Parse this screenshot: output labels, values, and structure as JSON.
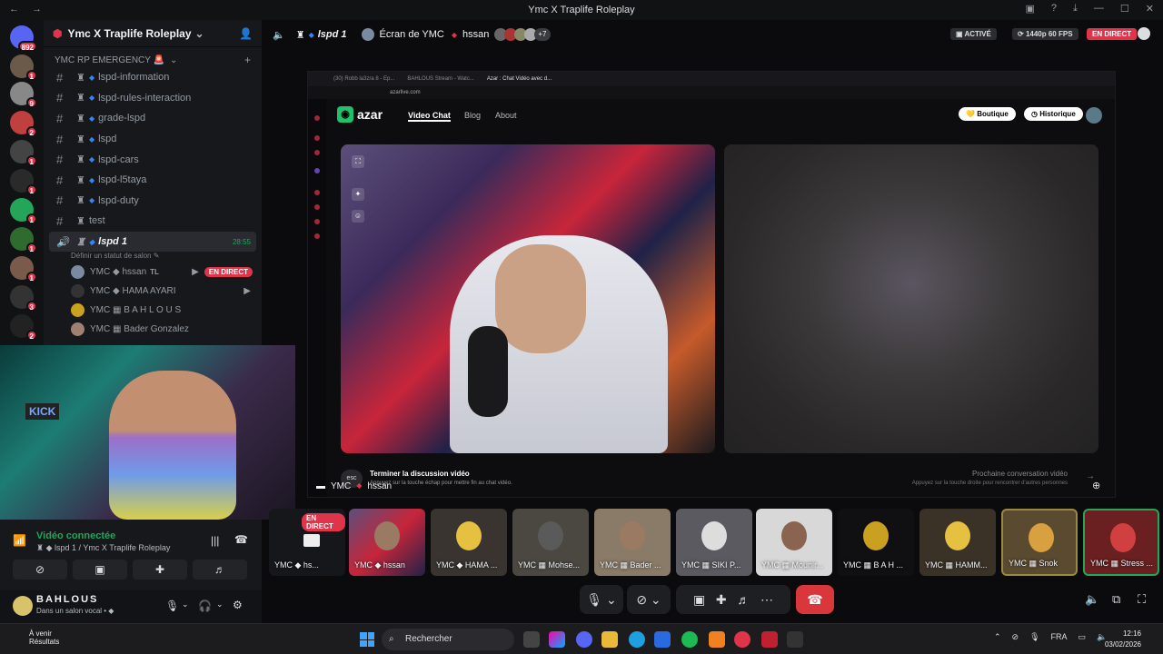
{
  "window": {
    "title": "Ymc X Traplife Roleplay"
  },
  "server": {
    "name": "Ymc X Traplife Roleplay",
    "rail_badges": [
      "892",
      "1",
      "9",
      "2",
      "1",
      "1",
      "1",
      "1",
      "1",
      "3",
      "2"
    ]
  },
  "channels": {
    "category": "YMC RP EMERGENCY 🚨",
    "list": [
      {
        "name": "lspd-information"
      },
      {
        "name": "lspd-rules-interaction"
      },
      {
        "name": "grade-lspd"
      },
      {
        "name": "lspd"
      },
      {
        "name": "lspd-cars"
      },
      {
        "name": "lspd-l5taya"
      },
      {
        "name": "lspd-duty"
      },
      {
        "name": "test"
      }
    ],
    "active_voice": {
      "name": "lspd 1",
      "time": "28:55",
      "status_placeholder": "Définir un statut de salon"
    },
    "voice_users": [
      {
        "name": "YMC ◆ hssan",
        "tag": "TL",
        "live": "EN DIRECT"
      },
      {
        "name": "YMC ◆ HAMA AYARI"
      },
      {
        "name": "YMC ▦ B A H L O U S"
      },
      {
        "name": "YMC ▦ Bader Gonzalez"
      }
    ]
  },
  "webcam": {
    "sign": "KICK"
  },
  "voice_panel": {
    "status": "Vidéo connectée",
    "subtitle": "lspd 1 / Ymc X Traplife Roleplay"
  },
  "user": {
    "name": "BAHLOUS",
    "status": "Dans un salon vocal • ◆"
  },
  "stage": {
    "channel": "lspd 1",
    "screen": "Écran de YMC",
    "user": "hssan",
    "extra_count": "+7",
    "active_label": "ACTIVÉ",
    "quality": "1440p 60 FPS",
    "live": "EN DIRECT"
  },
  "browser": {
    "tabs": [
      "(30) Robb la3zra 8 - Ep...",
      "BAHLOUS Stream - Watc...",
      "Azar : Chat Vidéo avec d..."
    ],
    "url": "azarlive.com"
  },
  "azar": {
    "logo": "azar",
    "nav": [
      "Video Chat",
      "Blog",
      "About"
    ],
    "boutique": "Boutique",
    "historique": "Historique",
    "end_title": "Terminer la discussion vidéo",
    "end_hint": "Appuyez sur la touche échap pour mettre fin au chat vidéo.",
    "esc": "esc",
    "next_title": "Prochaine conversation vidéo",
    "next_hint": "Appuyez sur la touche droite pour rencontrer d'autres personnes"
  },
  "stream_label": {
    "prefix": "YMC",
    "user": "hssan"
  },
  "participants": [
    {
      "label": "YMC ◆ hs...",
      "live": "EN DIRECT"
    },
    {
      "label": "YMC ◆ hssan"
    },
    {
      "label": "YMC ◆ HAMA ..."
    },
    {
      "label": "YMC ▦ Mohse..."
    },
    {
      "label": "YMC ▦ Bader ..."
    },
    {
      "label": "YMC ▦ SIKI P..."
    },
    {
      "label": "YMC ▦ Mounir..."
    },
    {
      "label": "YMC ▦ B A H ..."
    },
    {
      "label": "YMC ▦ HAMM..."
    },
    {
      "label": "YMC ▦ Snok"
    },
    {
      "label": "YMC ▦ Stress ..."
    }
  ],
  "taskbar": {
    "weather_title": "À venir",
    "weather_sub": "Résultats",
    "search": "Rechercher",
    "lang": "FRA",
    "time": "12:16",
    "date": "03/02/2026"
  },
  "colors": {
    "live": "#e0344b",
    "connected": "#23a55a",
    "accent": "#5865f2"
  }
}
